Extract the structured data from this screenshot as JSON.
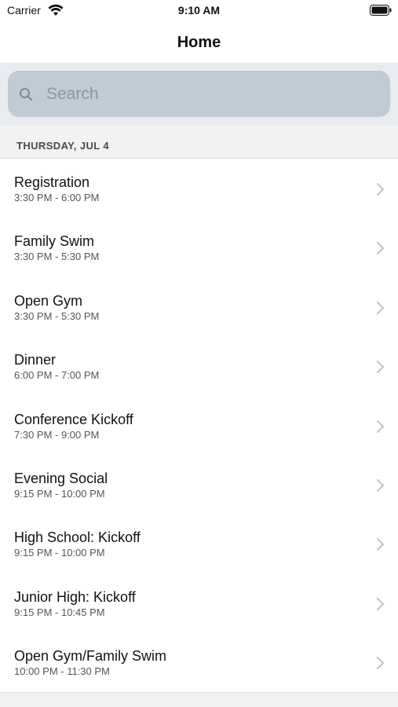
{
  "status_bar": {
    "carrier": "Carrier",
    "time": "9:10 AM"
  },
  "nav": {
    "title": "Home"
  },
  "search": {
    "placeholder": "Search"
  },
  "section": {
    "header": "THURSDAY, JUL 4"
  },
  "events": [
    {
      "title": "Registration",
      "time": "3:30 PM - 6:00 PM"
    },
    {
      "title": "Family Swim",
      "time": "3:30 PM - 5:30 PM"
    },
    {
      "title": "Open Gym",
      "time": "3:30 PM - 5:30 PM"
    },
    {
      "title": "Dinner",
      "time": "6:00 PM - 7:00 PM"
    },
    {
      "title": "Conference Kickoff",
      "time": "7:30 PM - 9:00 PM"
    },
    {
      "title": "Evening Social",
      "time": "9:15 PM - 10:00 PM"
    },
    {
      "title": "High School: Kickoff",
      "time": "9:15 PM - 10:00 PM"
    },
    {
      "title": "Junior High: Kickoff",
      "time": "9:15 PM - 10:45 PM"
    },
    {
      "title": "Open Gym/Family Swim",
      "time": "10:00 PM - 11:30 PM"
    }
  ],
  "icons": {
    "wifi": "wifi-icon",
    "battery": "battery-icon",
    "search": "search-icon",
    "chevron": "chevron-right-icon"
  }
}
